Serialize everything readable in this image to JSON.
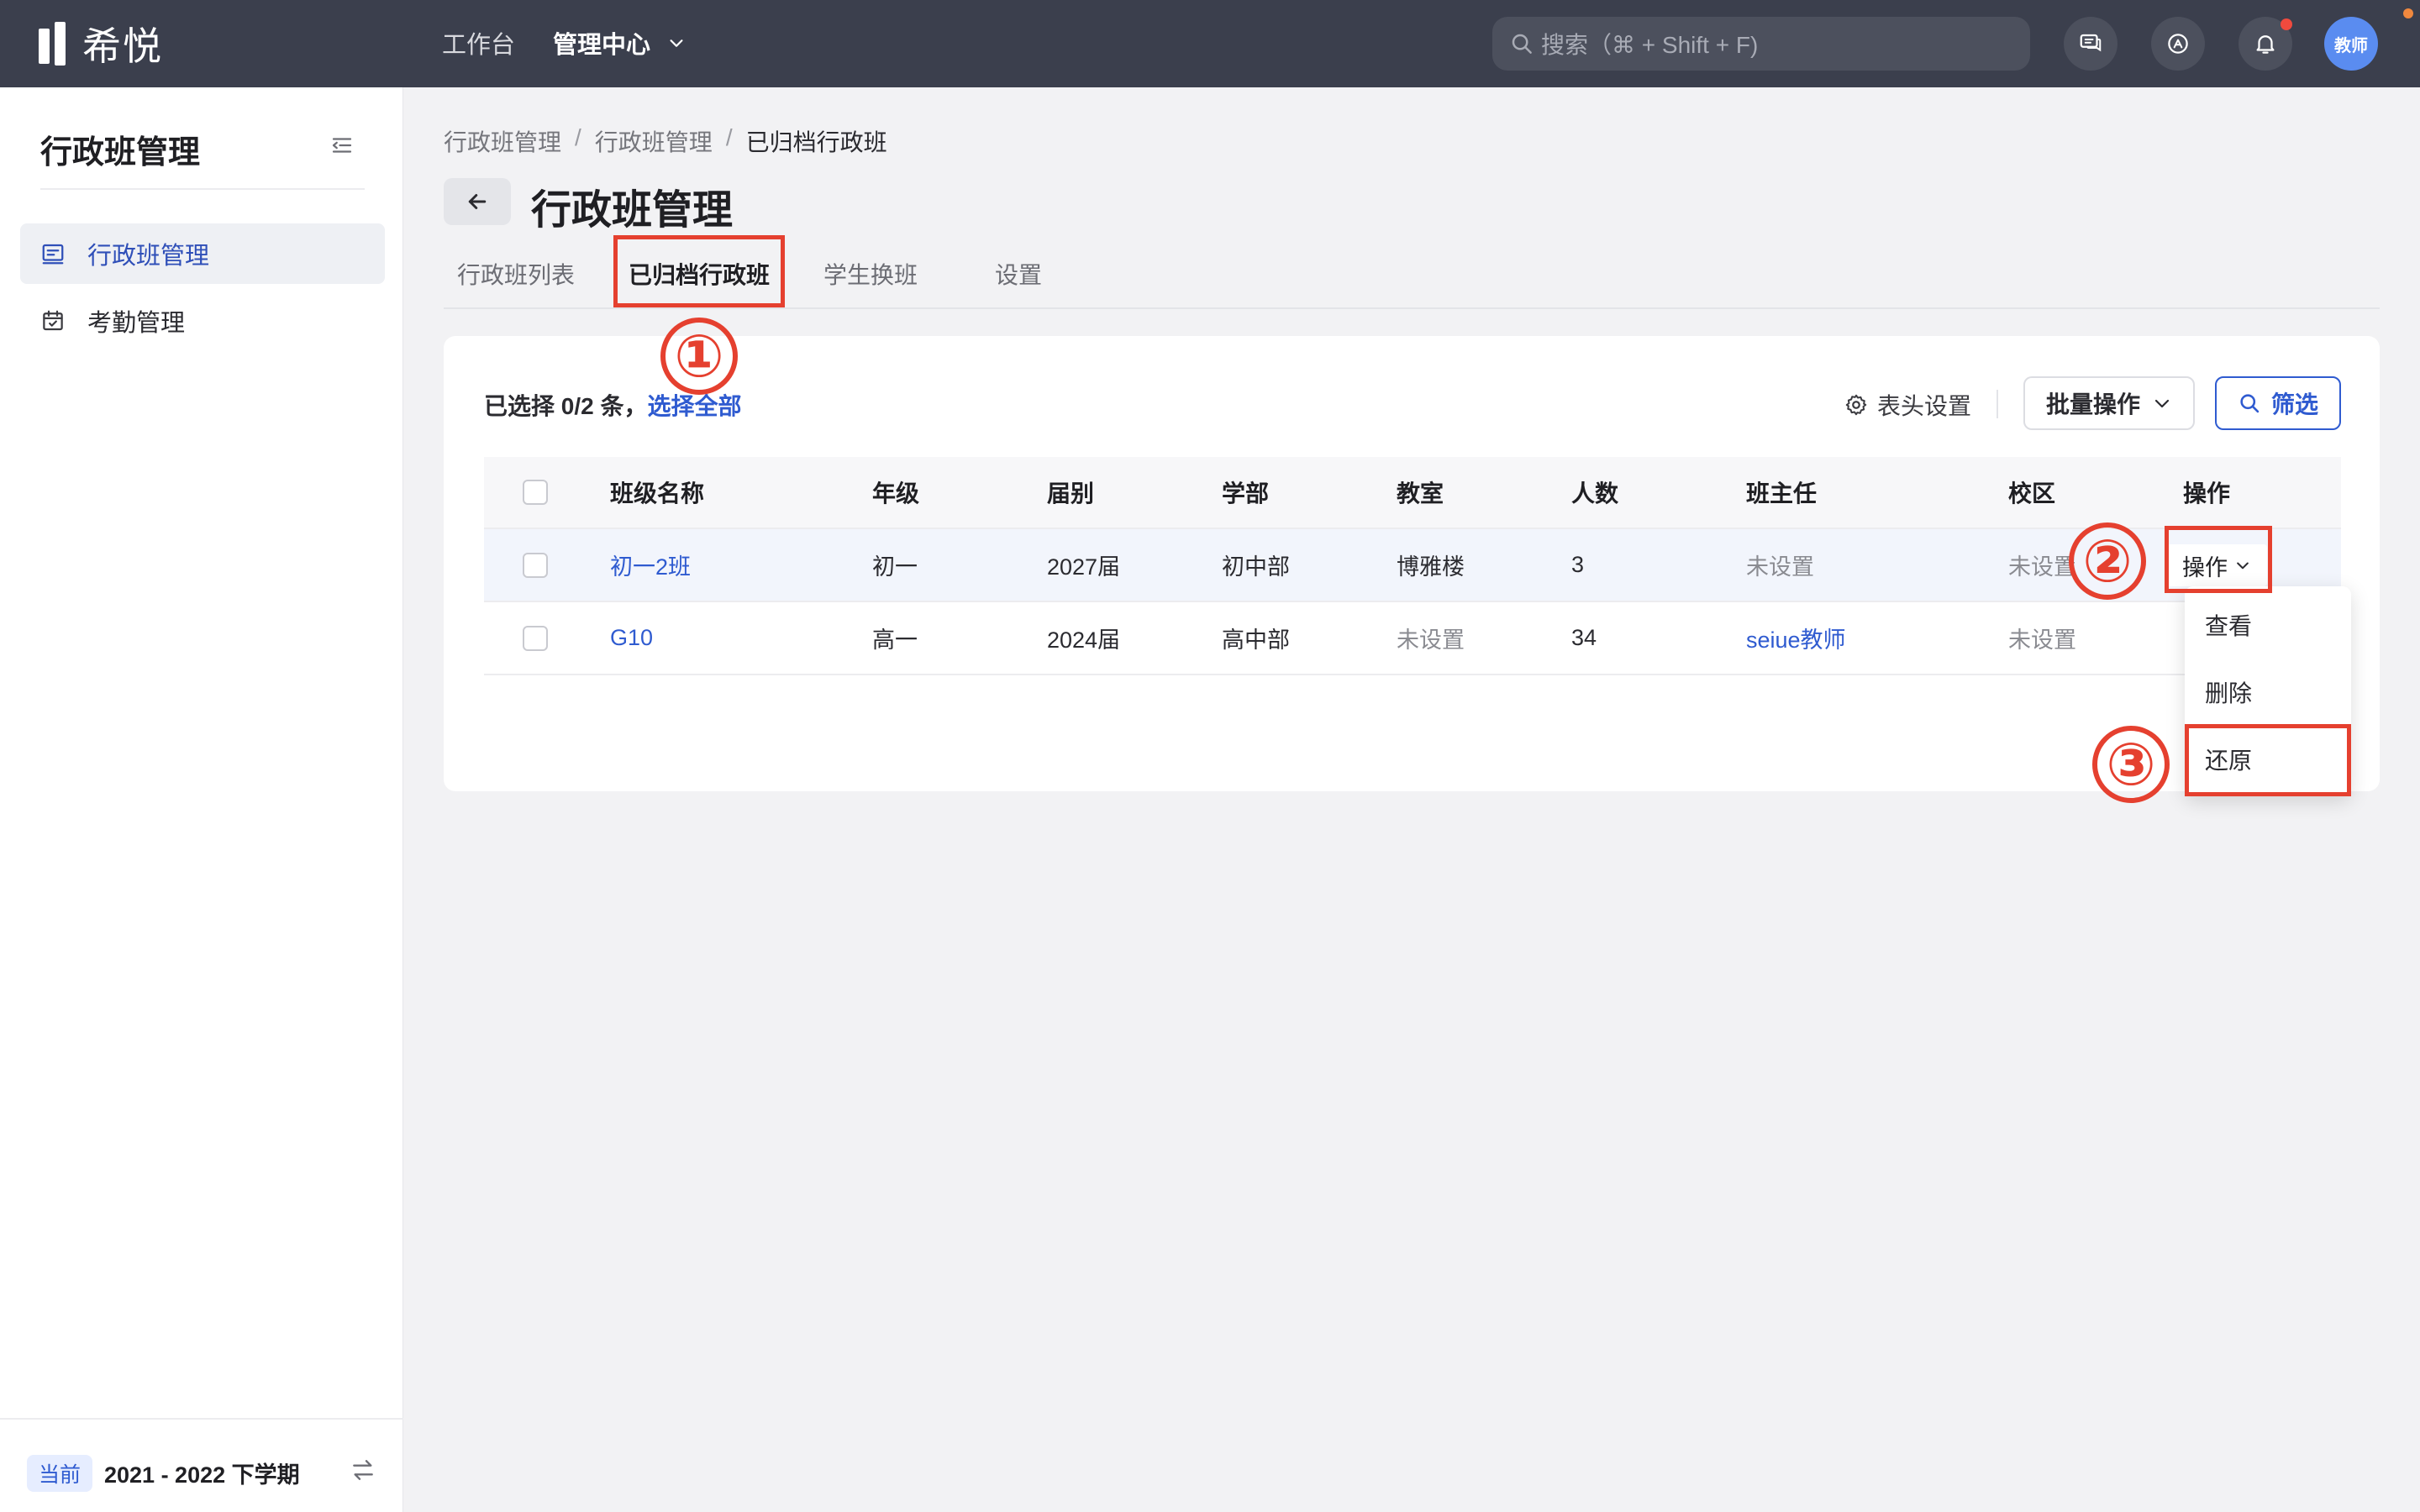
{
  "topbar": {
    "logo_text": "希悦",
    "nav_workbench": "工作台",
    "nav_admin": "管理中心",
    "search_placeholder": "搜索（⌘ + Shift + F)",
    "avatar_text": "教师",
    "icons": [
      "message-icon",
      "app-center-icon",
      "bell-icon"
    ]
  },
  "sidebar": {
    "title": "行政班管理",
    "items": [
      {
        "label": "行政班管理",
        "icon": "class-list-icon",
        "active": true
      },
      {
        "label": "考勤管理",
        "icon": "calendar-check-icon",
        "active": false
      }
    ],
    "footer": {
      "badge": "当前",
      "term": "2021 - 2022 下学期"
    }
  },
  "main": {
    "breadcrumb": [
      "行政班管理",
      "行政班管理",
      "已归档行政班"
    ],
    "breadcrumb_sep": "/",
    "title": "行政班管理",
    "tabs": [
      "行政班列表",
      "已归档行政班",
      "学生换班",
      "设置"
    ],
    "active_tab": "已归档行政班",
    "selection": {
      "prefix": "已选择 0/2 条，",
      "select_all": "选择全部"
    },
    "toolbar": {
      "column_settings": "表头设置",
      "batch": "批量操作",
      "filter": "筛选"
    },
    "table": {
      "headers": [
        "班级名称",
        "年级",
        "届别",
        "学部",
        "教室",
        "人数",
        "班主任",
        "校区",
        "操作"
      ],
      "rows": [
        {
          "name": "初一2班",
          "grade": "初一",
          "cohort": "2027届",
          "division": "初中部",
          "room": "博雅楼",
          "count": "3",
          "teacher": "未设置",
          "campus": "未设置",
          "op": "操作"
        },
        {
          "name": "G10",
          "grade": "高一",
          "cohort": "2024届",
          "division": "高中部",
          "room": "未设置",
          "count": "34",
          "teacher": "seiue教师",
          "campus": "未设置",
          "op": ""
        }
      ]
    },
    "dropdown": [
      "查看",
      "删除",
      "还原"
    ]
  },
  "annotations": {
    "color": "#e5402f",
    "steps": [
      "①",
      "②",
      "③"
    ]
  },
  "colors": {
    "accent": "#2f5bd0",
    "topbar": "#3b3f4d",
    "annotation": "#e5402f"
  }
}
